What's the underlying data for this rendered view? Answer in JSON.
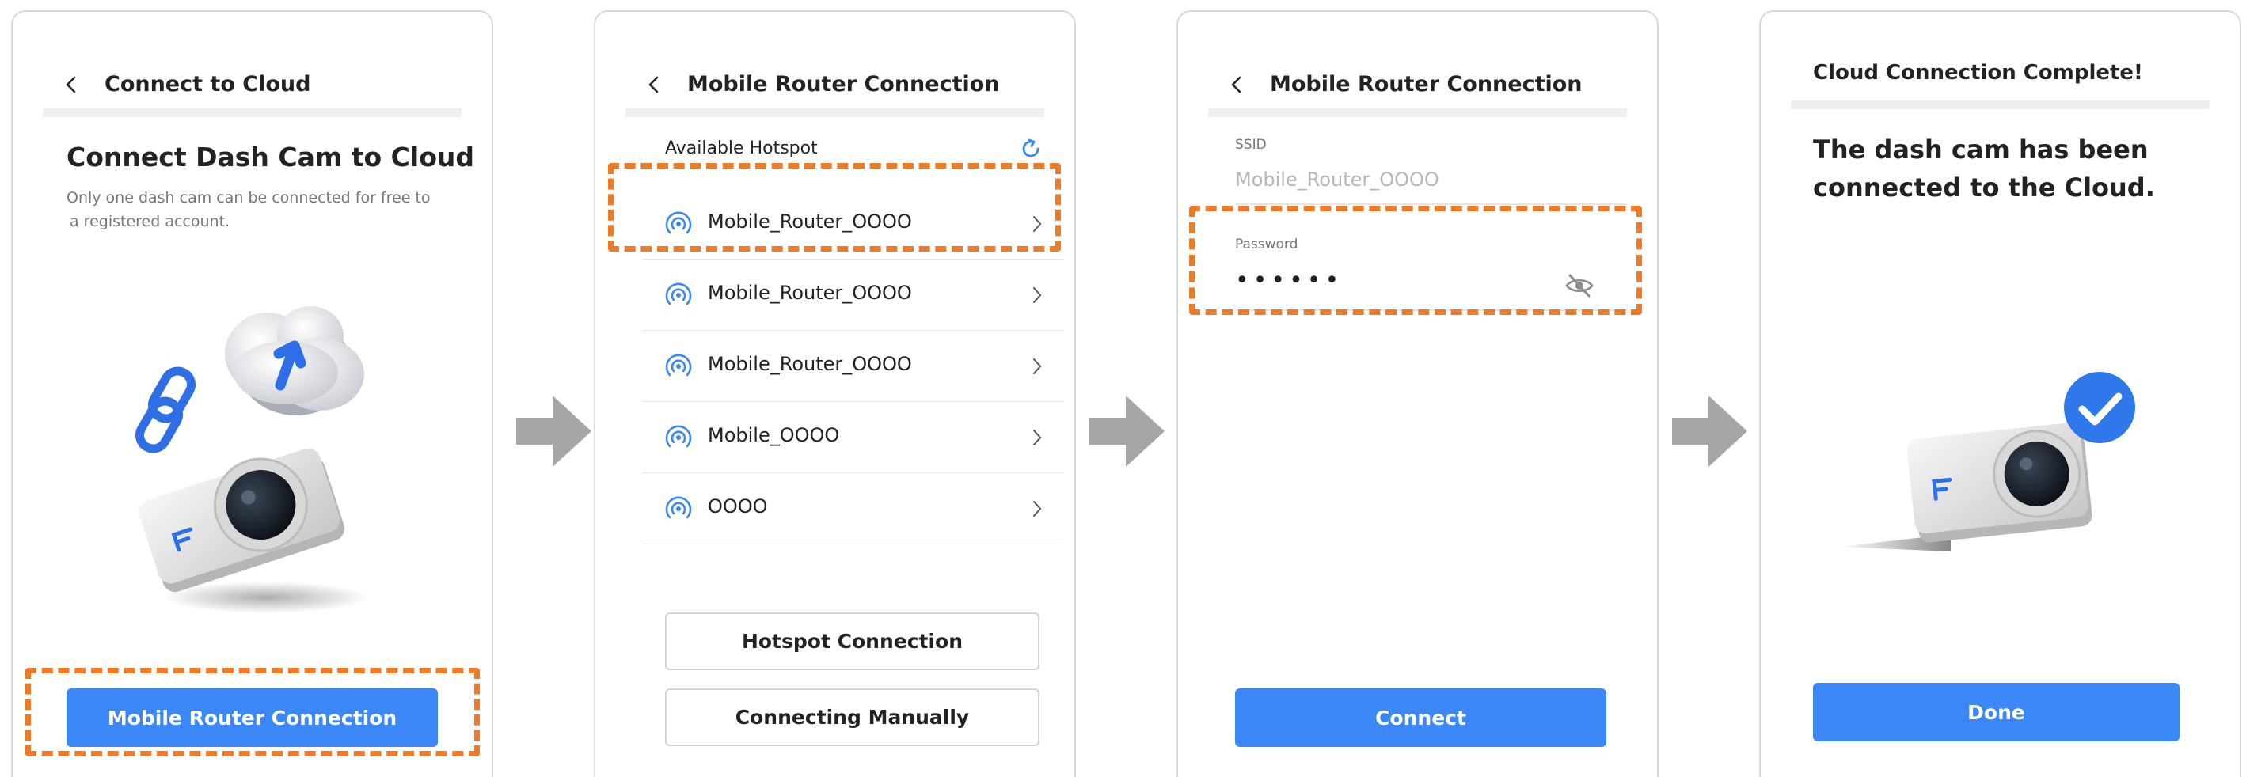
{
  "colors": {
    "accent": "#3a87f5",
    "highlight": "#ef7a28",
    "arrow": "#a6a6a6"
  },
  "panel1": {
    "header_title": "Connect to Cloud",
    "title": "Connect Dash Cam to Cloud",
    "subtitle_line1": "Only one dash cam can be connected for free to",
    "subtitle_line2": "a registered account.",
    "button": "Mobile Router Connection"
  },
  "panel2": {
    "header_title": "Mobile Router Connection",
    "available_label": "Available Hotspot",
    "hotspots": [
      {
        "name": "Mobile_Router_OOOO"
      },
      {
        "name": "Mobile_Router_OOOO"
      },
      {
        "name": "Mobile_Router_OOOO"
      },
      {
        "name": "Mobile_OOOO"
      },
      {
        "name": "OOOO"
      }
    ],
    "hotspot_button": "Hotspot Connection",
    "manual_button": "Connecting Manually"
  },
  "panel3": {
    "header_title": "Mobile Router Connection",
    "ssid_label": "SSID",
    "ssid_value": "Mobile_Router_OOOO",
    "password_label": "Password",
    "password_value": "••••••",
    "connect_button": "Connect"
  },
  "panel4": {
    "title": "Cloud Connection Complete!",
    "message_line1": "The dash cam has been",
    "message_line2": "connected to the Cloud.",
    "done_button": "Done"
  }
}
